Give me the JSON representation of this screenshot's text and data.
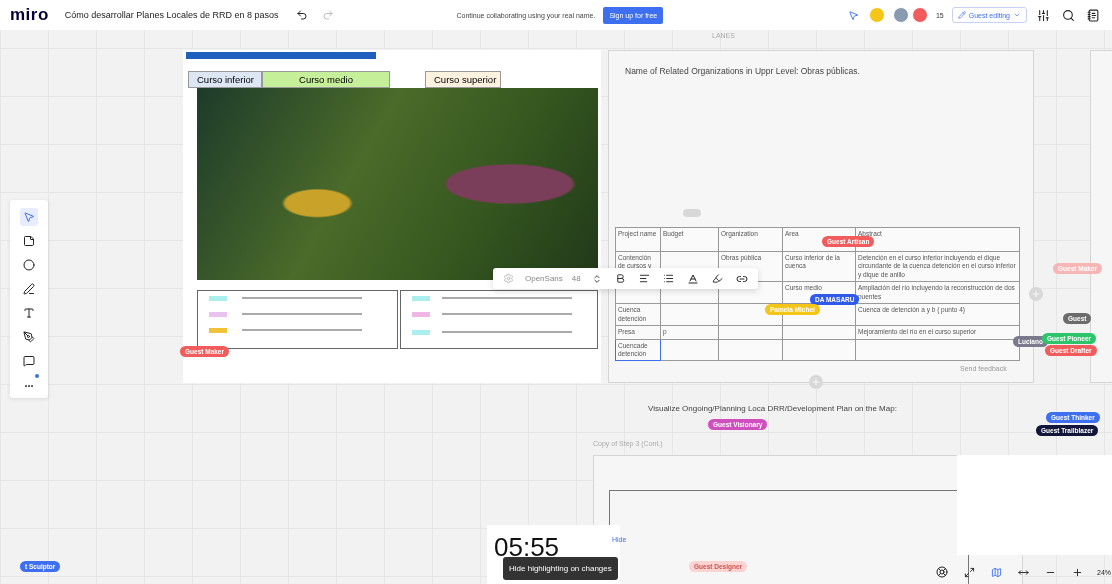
{
  "topbar": {
    "logo": "miro",
    "board_title": "Cómo desarrollar Planes Locales de RRD en 8 pasos",
    "prompt": "Continue collaborating using your real name.",
    "signup_button": "Sign up for free",
    "collaborator_count": "15",
    "mode_button": "Guest editing"
  },
  "tools": [
    {
      "kind": "select",
      "selected": true
    },
    {
      "kind": "sticky"
    },
    {
      "kind": "shape"
    },
    {
      "kind": "pen"
    },
    {
      "kind": "text"
    },
    {
      "kind": "draw"
    },
    {
      "kind": "comment"
    },
    {
      "kind": "more",
      "label": "..."
    }
  ],
  "slide": {
    "course_labels": [
      {
        "label": "Curso inferior",
        "color": "#dce6f5"
      },
      {
        "label": "Curso medio",
        "color": "#c6ef9a"
      },
      {
        "label": "Curso superior",
        "color": "#fdf1e0"
      }
    ]
  },
  "frame_title": "LANES",
  "frame_text": "Name of Related Organizations in Uppr Level: Obras públicas.",
  "table": {
    "columns": [
      "Project name",
      "Budget",
      "Organization",
      "Area",
      "Abstract"
    ],
    "rows": [
      {
        "cells": [
          "Contención de cursos y",
          "",
          "Obras pública",
          "Curso inferior de la cuenca",
          "Detención en el curso inferior incluyendo el dique circundante de la cuenca detención en el curso inferior y dique de anillo"
        ],
        "selected": false
      },
      {
        "cells": [
          "",
          "",
          "",
          "Curso medio",
          "Ampliación del río incluyendo la reconstrucción de dos puentes"
        ],
        "selected": false
      },
      {
        "cells": [
          "Cuenca detención",
          "",
          "",
          "",
          "Cuenca de detención a y b ( punto 4)"
        ],
        "selected": false
      },
      {
        "cells": [
          "Presa",
          "p",
          "",
          "",
          "Mejoramiento del río en el curso superior"
        ],
        "selected": false
      },
      {
        "cells": [
          "Cuencade detención",
          "",
          "",
          "",
          ""
        ],
        "selected": true
      }
    ]
  },
  "text_toolbar": {
    "font": "OpenSans",
    "size": "48"
  },
  "send_feedback": "Send feedback",
  "map_caption": "Visualize Ongoing/Planning Loca DRR/Development Plan on the Map:",
  "copy_frame_title": "Copy of Step 3 (Cont.)",
  "cursors": [
    {
      "name": "Guest Maker",
      "color": "#f25c5c"
    },
    {
      "name": "Guest Artisan",
      "color": "#f25c5c"
    },
    {
      "name": "Pamela Michel",
      "color": "#f5c518"
    },
    {
      "name": "DA MASARU",
      "color": "#2f5be8"
    },
    {
      "name": "Guest Maker",
      "color": "#f7b6b6"
    },
    {
      "name": "Guest",
      "color": "#6b6b6b"
    },
    {
      "name": "Luciano",
      "color": "#7a7a8c"
    },
    {
      "name": "Guest Pioneer",
      "color": "#2ec46b"
    },
    {
      "name": "Guest Drafter",
      "color": "#f25c5c"
    },
    {
      "name": "Guest Visionary",
      "color": "#d04fbf"
    },
    {
      "name": "Guest Thinker",
      "color": "#3d6ff0"
    },
    {
      "name": "Guest Trailblazer",
      "color": "#12163a"
    },
    {
      "name": "t Sculptor",
      "color": "#3d6ff0"
    },
    {
      "name": "Guest Designer",
      "color": "#fbd3d0"
    }
  ],
  "timer": {
    "time": "05:55",
    "hide": "Hide"
  },
  "tooltip": "Hide highlighting on changes",
  "zoom": "24%"
}
